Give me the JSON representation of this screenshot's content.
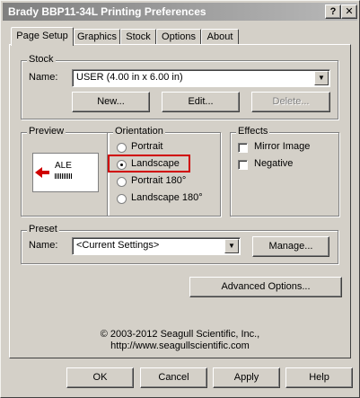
{
  "window": {
    "title": "Brady BBP11-34L Printing Preferences",
    "help_label": "?",
    "close_label": "✕"
  },
  "tabs": [
    {
      "label": "Page Setup",
      "active": true
    },
    {
      "label": "Graphics"
    },
    {
      "label": "Stock"
    },
    {
      "label": "Options"
    },
    {
      "label": "About"
    }
  ],
  "stock": {
    "group_label": "Stock",
    "name_label": "Name:",
    "selected": "USER (4.00 in x 6.00 in)",
    "new_label": "New...",
    "edit_label": "Edit...",
    "delete_label": "Delete..."
  },
  "preview": {
    "group_label": "Preview",
    "sample_text": "ALE"
  },
  "orientation": {
    "group_label": "Orientation",
    "options": [
      {
        "label": "Portrait",
        "checked": false
      },
      {
        "label": "Landscape",
        "checked": true
      },
      {
        "label": "Portrait 180°",
        "checked": false
      },
      {
        "label": "Landscape 180°",
        "checked": false
      }
    ]
  },
  "effects": {
    "group_label": "Effects",
    "mirror_label": "Mirror Image",
    "mirror_checked": false,
    "negative_label": "Negative",
    "negative_checked": false
  },
  "preset": {
    "group_label": "Preset",
    "name_label": "Name:",
    "selected": "<Current Settings>",
    "manage_label": "Manage..."
  },
  "advanced_label": "Advanced Options...",
  "copyright": {
    "line1": "© 2003-2012 Seagull Scientific, Inc.,",
    "line2": "http://www.seagullscientific.com"
  },
  "footer": {
    "ok": "OK",
    "cancel": "Cancel",
    "apply": "Apply",
    "help": "Help"
  },
  "colors": {
    "titlebar_start": "#7f7f7f",
    "highlight": "#d00000",
    "face": "#d4d0c8"
  }
}
